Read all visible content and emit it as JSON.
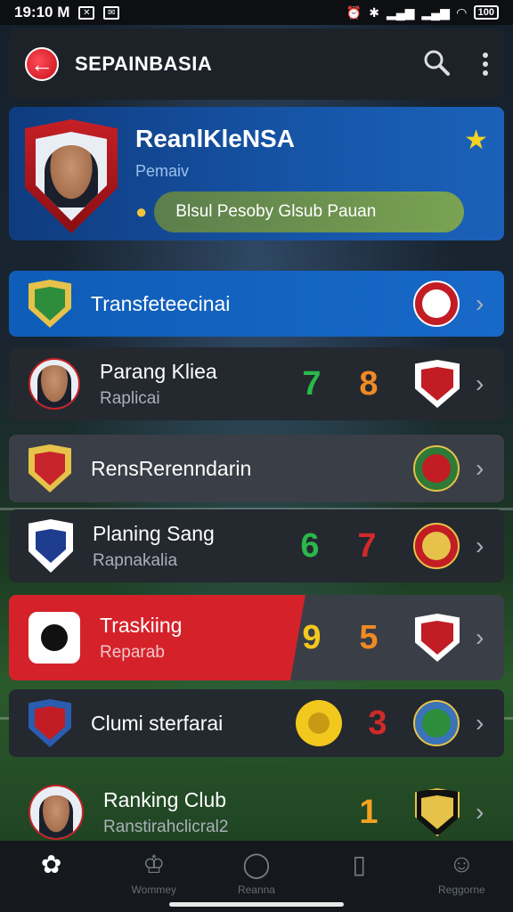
{
  "status_bar": {
    "time": "19:10 M",
    "battery": "100"
  },
  "app": {
    "title": "SEPAINBASIA"
  },
  "profile": {
    "name": "ReanlKleNSA",
    "subtitle": "Pemaiv",
    "pill_label": "Blsul Pesoby Glsub Pauan"
  },
  "list": [
    {
      "title": "Transfeteecinai",
      "subtitle": "",
      "score_left": "",
      "score_right": ""
    },
    {
      "title": "Parang Kliea",
      "subtitle": "Raplicai",
      "score_left": "7",
      "score_right": "8"
    },
    {
      "title": "RensRerenndarin",
      "subtitle": "",
      "score_left": "",
      "score_right": ""
    },
    {
      "title": "Planing Sang",
      "subtitle": "Rapnakalia",
      "score_left": "6",
      "score_right": "7"
    },
    {
      "title": "Traskiing",
      "subtitle": "Reparab",
      "score_left": "9",
      "score_right": "5"
    },
    {
      "title": "Clumi sterfarai",
      "subtitle": "",
      "score_left": "",
      "score_right": "3"
    },
    {
      "title": "Ranking Club",
      "subtitle": "Ranstirahclicral2",
      "score_left": "",
      "score_right": "1"
    }
  ],
  "nav": [
    {
      "label": ""
    },
    {
      "label": "Wommey"
    },
    {
      "label": "Reanna"
    },
    {
      "label": ""
    },
    {
      "label": "Reggorne"
    }
  ],
  "colors": {
    "accent_blue": "#1868c8",
    "accent_red": "#d5222a",
    "score_green": "#2bb84a",
    "score_orange": "#f08a24",
    "score_yellow": "#f2c81f",
    "score_red": "#d02a2a"
  }
}
